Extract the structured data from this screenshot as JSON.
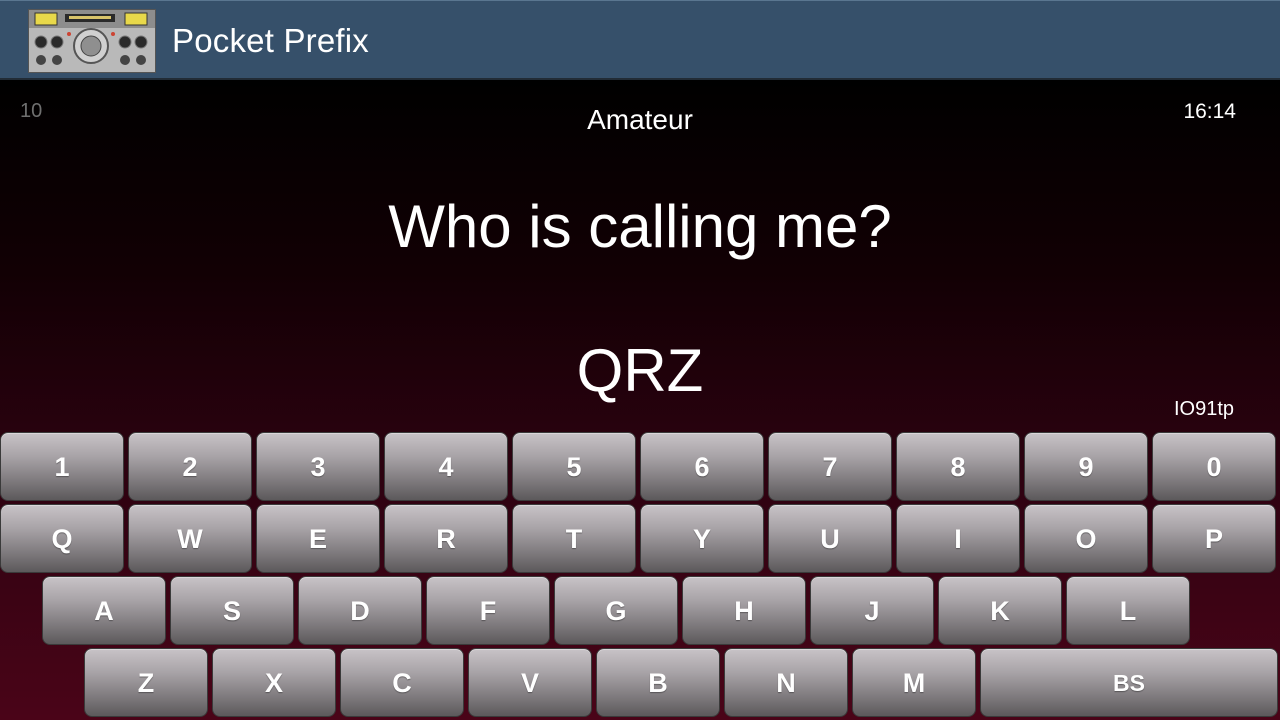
{
  "app": {
    "title": "Pocket Prefix",
    "icon": "radio-transceiver-icon"
  },
  "status": {
    "counter": "10",
    "mode": "Amateur",
    "time": "16:14",
    "locator": "IO91tp"
  },
  "quiz": {
    "question": "Who is calling me?",
    "callsign": "QRZ"
  },
  "keyboard": {
    "row1": [
      "1",
      "2",
      "3",
      "4",
      "5",
      "6",
      "7",
      "8",
      "9",
      "0"
    ],
    "row2": [
      "Q",
      "W",
      "E",
      "R",
      "T",
      "Y",
      "U",
      "I",
      "O",
      "P"
    ],
    "row3": [
      "A",
      "S",
      "D",
      "F",
      "G",
      "H",
      "J",
      "K",
      "L"
    ],
    "row4": [
      "Z",
      "X",
      "C",
      "V",
      "B",
      "N",
      "M"
    ],
    "backspace_label": "BS"
  },
  "colors": {
    "action_bar": "#36506a",
    "background_bottom": "#4a0418",
    "key_top": "#c8c3c7",
    "key_bottom": "#5c595b"
  }
}
